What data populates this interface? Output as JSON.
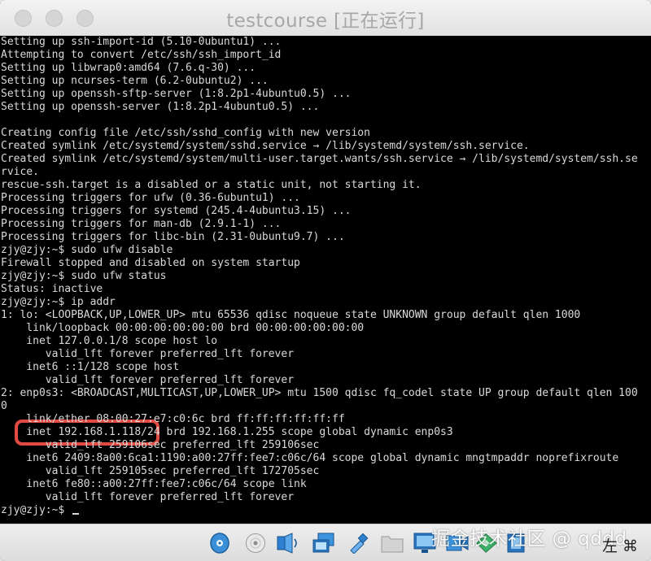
{
  "window": {
    "title": "testcourse [正在运行]"
  },
  "terminal": {
    "lines": [
      "Setting up ssh-import-id (5.10-0ubuntu1) ...",
      "Attempting to convert /etc/ssh/ssh_import_id",
      "Setting up libwrap0:amd64 (7.6.q-30) ...",
      "Setting up ncurses-term (6.2-0ubuntu2) ...",
      "Setting up openssh-sftp-server (1:8.2p1-4ubuntu0.5) ...",
      "Setting up openssh-server (1:8.2p1-4ubuntu0.5) ...",
      "",
      "Creating config file /etc/ssh/sshd_config with new version",
      "Created symlink /etc/systemd/system/sshd.service → /lib/systemd/system/ssh.service.",
      "Created symlink /etc/systemd/system/multi-user.target.wants/ssh.service → /lib/systemd/system/ssh.se",
      "rvice.",
      "rescue-ssh.target is a disabled or a static unit, not starting it.",
      "Processing triggers for ufw (0.36-6ubuntu1) ...",
      "Processing triggers for systemd (245.4-4ubuntu3.15) ...",
      "Processing triggers for man-db (2.9.1-1) ...",
      "Processing triggers for libc-bin (2.31-0ubuntu9.7) ...",
      "zjy@zjy:~$ sudo ufw disable",
      "Firewall stopped and disabled on system startup",
      "zjy@zjy:~$ sudo ufw status",
      "Status: inactive",
      "zjy@zjy:~$ ip addr",
      "1: lo: <LOOPBACK,UP,LOWER_UP> mtu 65536 qdisc noqueue state UNKNOWN group default qlen 1000",
      "    link/loopback 00:00:00:00:00:00 brd 00:00:00:00:00:00",
      "    inet 127.0.0.1/8 scope host lo",
      "       valid_lft forever preferred_lft forever",
      "    inet6 ::1/128 scope host",
      "       valid_lft forever preferred_lft forever",
      "2: enp0s3: <BROADCAST,MULTICAST,UP,LOWER_UP> mtu 1500 qdisc fq_codel state UP group default qlen 100",
      "0",
      "    link/ether 08:00:27:e7:c0:6c brd ff:ff:ff:ff:ff:ff",
      "    inet 192.168.1.118/24 brd 192.168.1.255 scope global dynamic enp0s3",
      "       valid_lft 259106sec preferred_lft 259106sec",
      "    inet6 2409:8a00:6ca1:1190:a00:27ff:fee7:c06c/64 scope global dynamic mngtmpaddr noprefixroute",
      "       valid_lft 259105sec preferred_lft 172705sec",
      "    inet6 fe80::a00:27ff:fee7:c06c/64 scope link",
      "       valid_lft forever preferred_lft forever",
      "zjy@zjy:~$ "
    ],
    "colors": {
      "background": "#000000",
      "foreground": "#d9d9d9",
      "highlight": "#e24b43"
    }
  },
  "statusbar": {
    "icons": [
      "hard-disk-icon",
      "optical-drive-icon",
      "audio-icon",
      "network-icon",
      "usb-icon",
      "shared-folders-icon",
      "display-icon",
      "recording-icon",
      "mouse-integration-icon",
      "cpu-indicator-icon"
    ],
    "host_key": "左 ⌘",
    "watermark": "掘金技术社区 @ qddd"
  }
}
